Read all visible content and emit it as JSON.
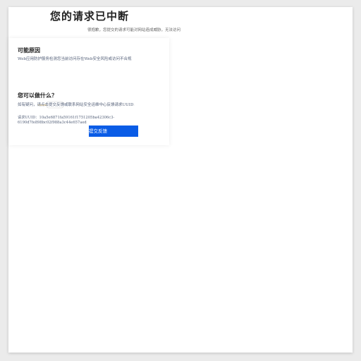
{
  "header": {
    "title": "您的请求已中断",
    "subtitle": "很抱歉，您提交的请求可能对网站造成威胁，无法访问"
  },
  "reasons": {
    "heading": "可能原因",
    "text": "Web应用防护服务检测您当前访问存在Web安全风险或访问不合规"
  },
  "actions": {
    "heading": "您可以做什么？",
    "text": "如有疑问，请点击提交反馈或联系网站安全运维中心反馈请求UUID",
    "uuid_label": "请求UUID：",
    "uuid_value": "10a5e6871fa59161f1751205ba42306c3-6190d7fe898bc02f988a3c44e657aed",
    "feedback_button": "提交反馈"
  },
  "colors": {
    "accent": "#0a5ce6",
    "page_bg": "#ffffff",
    "outer_bg": "#ebebeb"
  }
}
